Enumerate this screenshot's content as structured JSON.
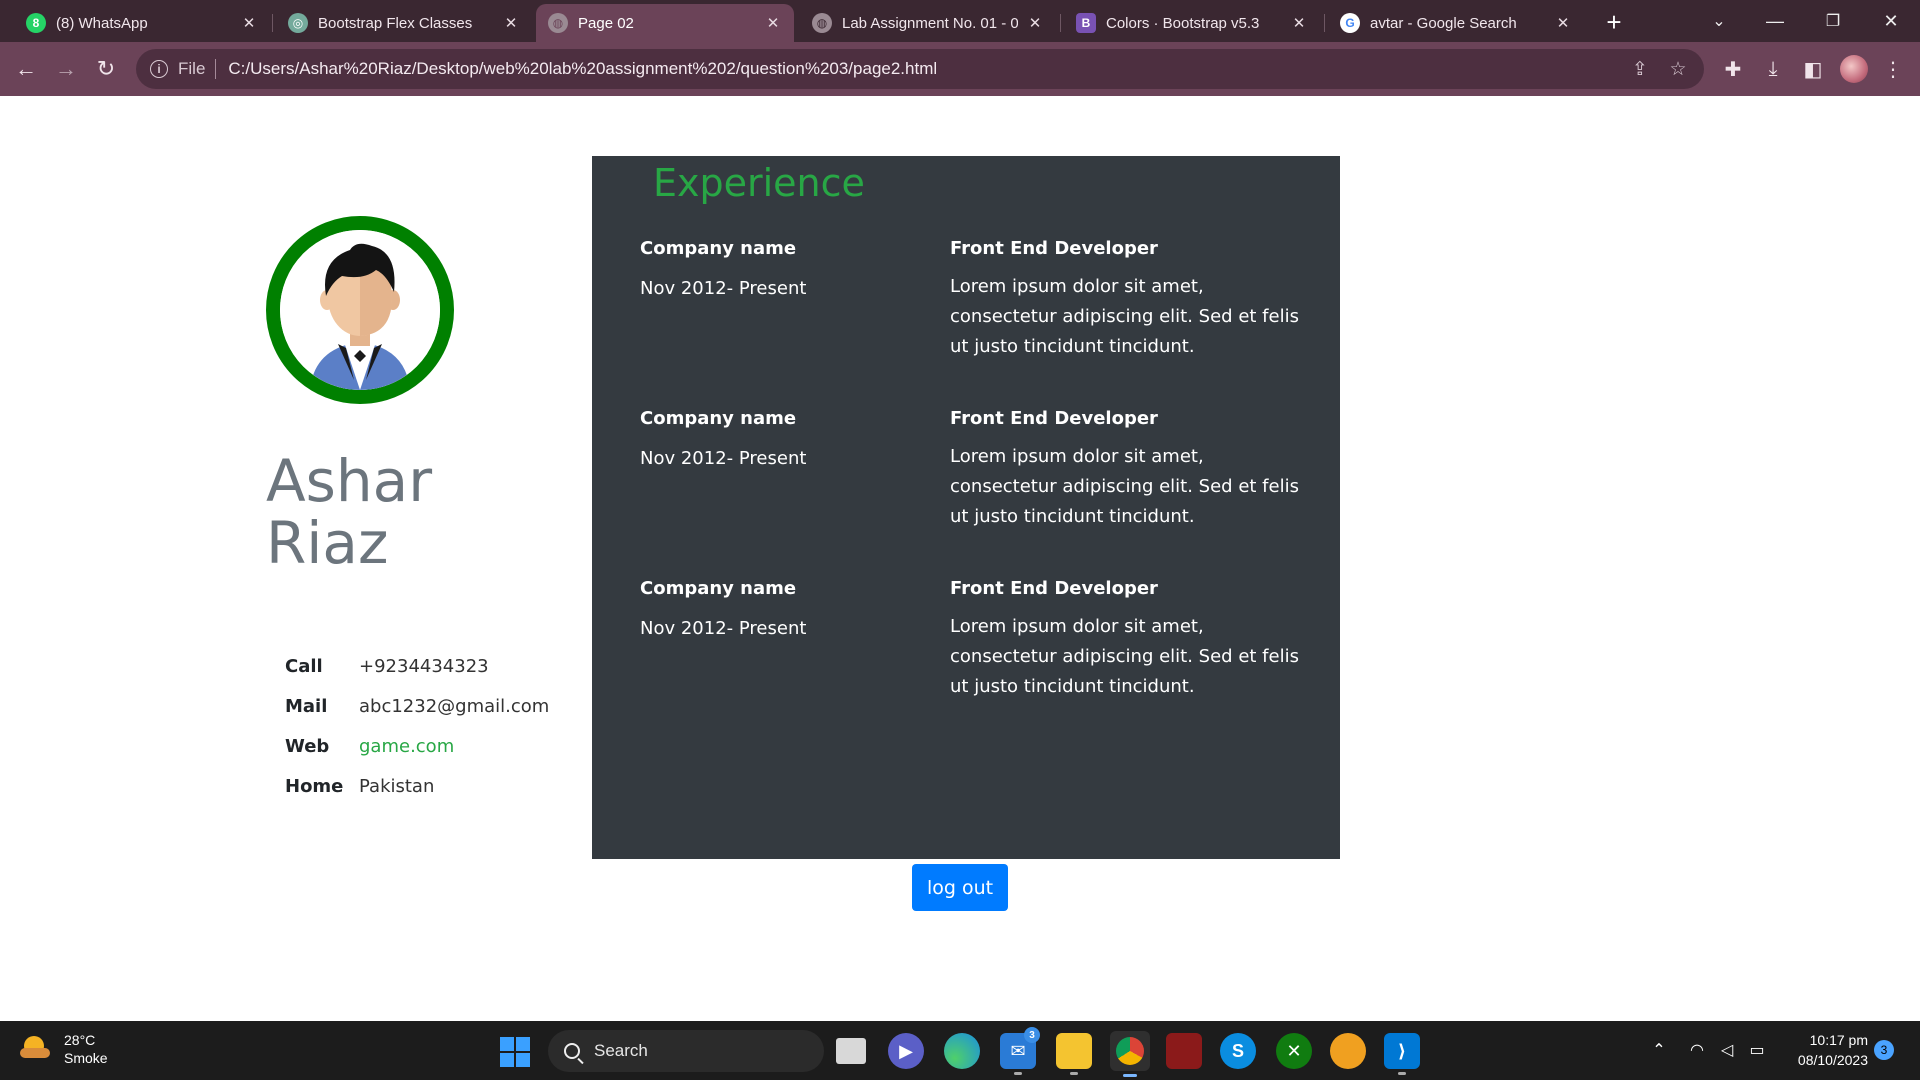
{
  "browser": {
    "tabs": [
      {
        "title": "(8) WhatsApp",
        "icon": "whatsapp-icon",
        "color": "#25d366",
        "glyph": "8"
      },
      {
        "title": "Bootstrap Flex Classes",
        "icon": "openai-icon",
        "color": "#74aa9c",
        "glyph": "◎"
      },
      {
        "title": "Page 02",
        "icon": "globe-icon",
        "color": "#9a8a93",
        "glyph": "◍"
      },
      {
        "title": "Lab Assignment No. 01 - 0",
        "icon": "globe-icon",
        "color": "#9a8a93",
        "glyph": "◍"
      },
      {
        "title": "Colors · Bootstrap v5.3",
        "icon": "bootstrap-icon",
        "color": "#7952b3",
        "glyph": "B"
      },
      {
        "title": "avtar - Google Search",
        "icon": "google-icon",
        "color": "#ffffff",
        "glyph": "G"
      }
    ],
    "active_tab": 2,
    "address": {
      "scheme_label": "File",
      "url": "C:/Users/Ashar%20Riaz/Desktop/web%20lab%20assignment%202/question%203/page2.html"
    }
  },
  "profile": {
    "first_name": "Ashar",
    "last_name": "Riaz",
    "ring_color": "#008000",
    "contacts": [
      {
        "label": "Call",
        "value": "+9234434323"
      },
      {
        "label": "Mail",
        "value": "abc1232@gmail.com"
      },
      {
        "label": "Web",
        "value": "game.com"
      },
      {
        "label": "Home",
        "value": "Pakistan"
      }
    ]
  },
  "experience": {
    "heading": "Experience",
    "entries": [
      {
        "company": "Company name",
        "period": "Nov 2012- Present",
        "role": "Front End Developer",
        "description": "Lorem ipsum dolor sit amet, consectetur adipiscing elit. Sed et felis ut justo tincidunt tincidunt."
      },
      {
        "company": "Company name",
        "period": "Nov 2012- Present",
        "role": "Front End Developer",
        "description": "Lorem ipsum dolor sit amet, consectetur adipiscing elit. Sed et felis ut justo tincidunt tincidunt."
      },
      {
        "company": "Company name",
        "period": "Nov 2012- Present",
        "role": "Front End Developer",
        "description": "Lorem ipsum dolor sit amet, consectetur adipiscing elit. Sed et felis ut justo tincidunt tincidunt."
      }
    ]
  },
  "logout_label": "log out",
  "taskbar": {
    "weather_temp": "28°C",
    "weather_desc": "Smoke",
    "search_placeholder": "Search",
    "clock_time": "10:17 pm",
    "clock_date": "08/10/2023",
    "mail_badge": "3",
    "notification_count": "3"
  }
}
